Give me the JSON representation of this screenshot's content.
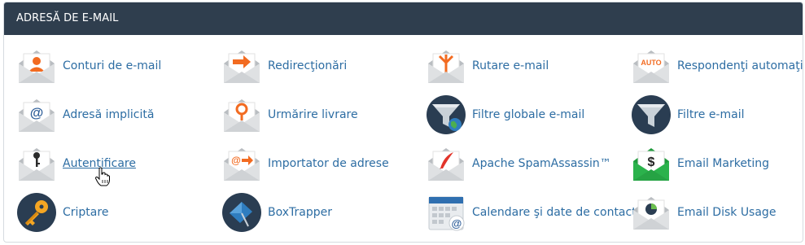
{
  "section": {
    "title": "ADRESĂ DE E-MAIL"
  },
  "colors": {
    "header_bg": "#2f3e4e",
    "link": "#2d6da3",
    "accent_orange": "#f26b21"
  },
  "items": [
    {
      "label": "Conturi de e-mail",
      "icon": "account-envelope-icon"
    },
    {
      "label": "Redirecţionări",
      "icon": "forward-arrow-envelope-icon"
    },
    {
      "label": "Rutare e-mail",
      "icon": "routing-fork-envelope-icon"
    },
    {
      "label": "Respondenţi automaţi",
      "icon": "auto-responder-envelope-icon"
    },
    {
      "label": "Adresă implicită",
      "icon": "at-sign-envelope-icon"
    },
    {
      "label": "Urmărire livrare",
      "icon": "location-pin-envelope-icon"
    },
    {
      "label": "Filtre globale e-mail",
      "icon": "funnel-globe-icon"
    },
    {
      "label": "Filtre e-mail",
      "icon": "funnel-icon"
    },
    {
      "label": "Autentificare",
      "icon": "key-envelope-icon"
    },
    {
      "label": "Importator de adrese",
      "icon": "import-envelope-icon"
    },
    {
      "label": "Apache SpamAssassin™",
      "icon": "feather-envelope-icon"
    },
    {
      "label": "Email Marketing",
      "icon": "dollar-envelope-icon"
    },
    {
      "label": "Criptare",
      "icon": "encryption-key-icon"
    },
    {
      "label": "BoxTrapper",
      "icon": "box-trap-icon"
    },
    {
      "label": "Calendare şi date de contact",
      "icon": "calendar-at-icon"
    },
    {
      "label": "Email Disk Usage",
      "icon": "pie-chart-envelope-icon"
    }
  ],
  "icon_text": {
    "auto": "AUTO",
    "at": "@",
    "dollar": "$"
  }
}
